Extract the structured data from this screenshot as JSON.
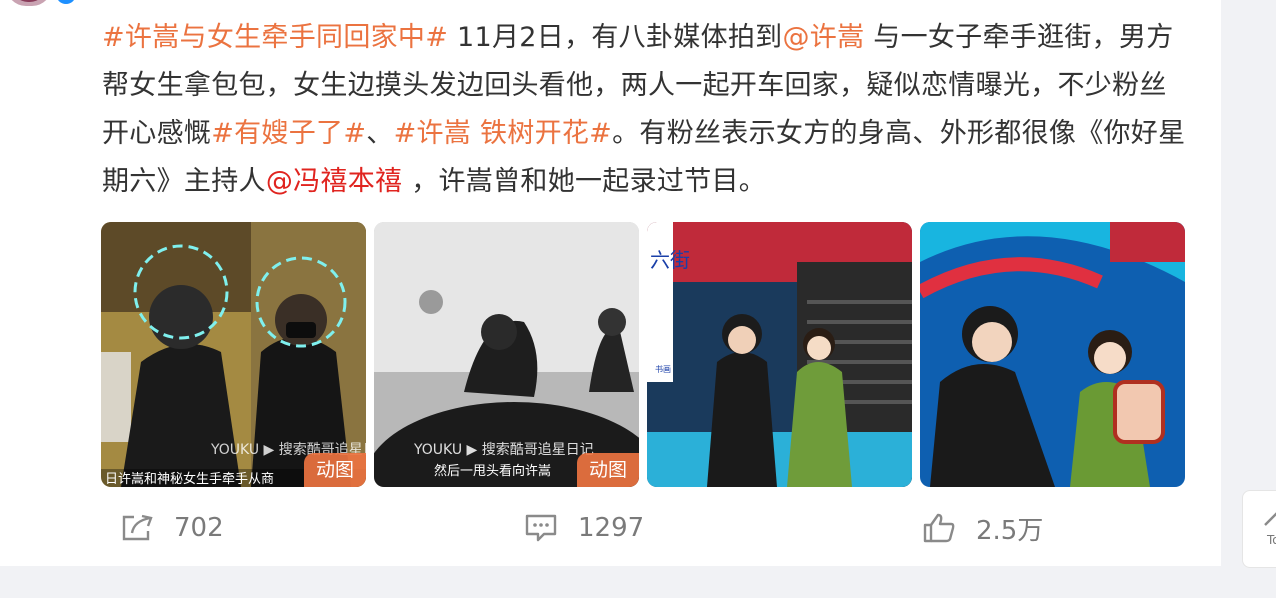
{
  "post": {
    "segments": [
      {
        "text": "#许嵩与女生牵手同回家中#",
        "kind": "topic"
      },
      {
        "text": " 11月2日，有八卦媒体拍到",
        "kind": "plain"
      },
      {
        "text": "@许嵩",
        "kind": "mention"
      },
      {
        "text": " 与一女子牵手逛街，男方帮女生拿包包，女生边摸头发边回头看他，两人一起开车回家，疑似恋情曝光，不少粉丝开心感慨",
        "kind": "plain"
      },
      {
        "text": "#有嫂子了#",
        "kind": "topic"
      },
      {
        "text": "、",
        "kind": "plain"
      },
      {
        "text": "#许嵩 铁树开花#",
        "kind": "topic"
      },
      {
        "text": "。有粉丝表示女方的身高、外形都很像《你好星期六》主持人",
        "kind": "plain"
      },
      {
        "text": "@冯禧本禧",
        "kind": "mention-red"
      },
      {
        "text": " ，许嵩曾和她一起录过节目。",
        "kind": "plain"
      }
    ]
  },
  "media": [
    {
      "badge": "动图",
      "subtitle": "日许嵩和神秘女生手牵手从商",
      "watermark": "YOUKU ▶ 搜索酷哥追星日记"
    },
    {
      "badge": "动图",
      "subtitle": "然后一甩头看向许嵩",
      "watermark": "YOUKU ▶ 搜索酷哥追星日记"
    },
    {
      "badge": "",
      "sign": "六街",
      "sign_small": "书画"
    },
    {
      "badge": ""
    }
  ],
  "actions": {
    "repost_count": "702",
    "comment_count": "1297",
    "like_count": "2.5万",
    "repost_icon": "share-icon",
    "comment_icon": "comment-icon",
    "like_icon": "thumbs-up-icon"
  },
  "side": {
    "label": "To"
  },
  "colors": {
    "topic": "#eb7340",
    "mention_red": "#e0241f",
    "badge": "#eb7340"
  }
}
